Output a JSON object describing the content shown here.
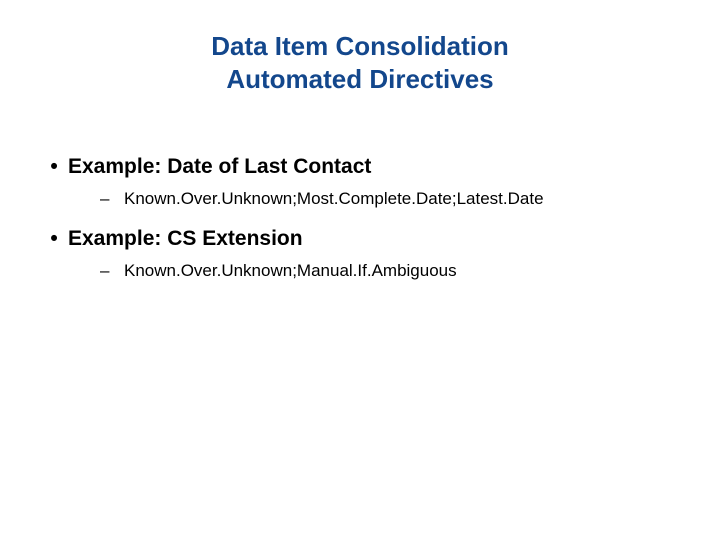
{
  "title": {
    "line1": "Data Item Consolidation",
    "line2": "Automated Directives"
  },
  "bullets": [
    {
      "header": "Example: Date of Last Contact",
      "sub": "Known.Over.Unknown;Most.Complete.Date;Latest.Date"
    },
    {
      "header": "Example: CS Extension",
      "sub": "Known.Over.Unknown;Manual.If.Ambiguous"
    }
  ]
}
